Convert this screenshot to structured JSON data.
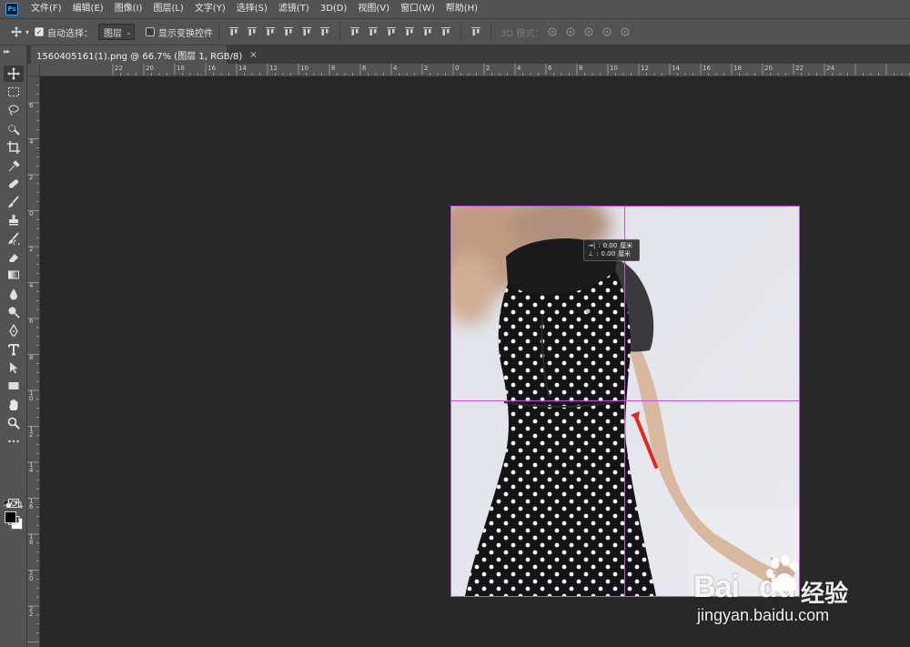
{
  "app": {
    "logo": "Ps"
  },
  "menu": [
    "文件(F)",
    "编辑(E)",
    "图像(I)",
    "图层(L)",
    "文字(Y)",
    "选择(S)",
    "滤镜(T)",
    "3D(D)",
    "视图(V)",
    "窗口(W)",
    "帮助(H)"
  ],
  "options": {
    "auto_select_label": "自动选择：",
    "auto_select_value": "图层",
    "show_transform_label": "显示变换控件",
    "mode_3d_label": "3D 模式："
  },
  "document_tab": {
    "title": "1560405161(1).png @ 66.7% (图层 1, RGB/8)",
    "close": "×"
  },
  "ruler_top_labels": [
    "22",
    "20",
    "18",
    "16",
    "14",
    "12",
    "10",
    "8",
    "6",
    "4",
    "2",
    "0",
    "2",
    "4",
    "6",
    "8",
    "10",
    "12",
    "14",
    "16",
    "18",
    "20",
    "22",
    "24"
  ],
  "ruler_left_labels": [
    "6",
    "4",
    "2",
    "0",
    "2",
    "4",
    "6",
    "8",
    "1 0",
    "1 2",
    "1 4",
    "1 6",
    "1 8",
    "2 0",
    "2 2"
  ],
  "readout": {
    "x_icon": "→|",
    "x_value": "0.00",
    "y_icon": "⊥",
    "y_value": "0.00",
    "unit": "厘米"
  },
  "watermark": {
    "brand": "Bai",
    "brand2": "du",
    "cn": "经验",
    "url": "jingyan.baidu.com"
  },
  "colors": {
    "chrome": "#535353",
    "canvas_bg": "#282828",
    "guide": "#c552d8",
    "arrow": "#e8251a",
    "foreground": "#000000",
    "background": "#ffffff"
  },
  "tools": [
    "move-tool",
    "marquee-tool",
    "lasso-tool",
    "quick-select-tool",
    "crop-tool",
    "eyedropper-tool",
    "healing-brush-tool",
    "brush-tool",
    "clone-stamp-tool",
    "history-brush-tool",
    "eraser-tool",
    "gradient-tool",
    "blur-tool",
    "dodge-tool",
    "pen-tool",
    "type-tool",
    "path-select-tool",
    "rectangle-tool",
    "hand-tool",
    "zoom-tool",
    "more-tools"
  ]
}
